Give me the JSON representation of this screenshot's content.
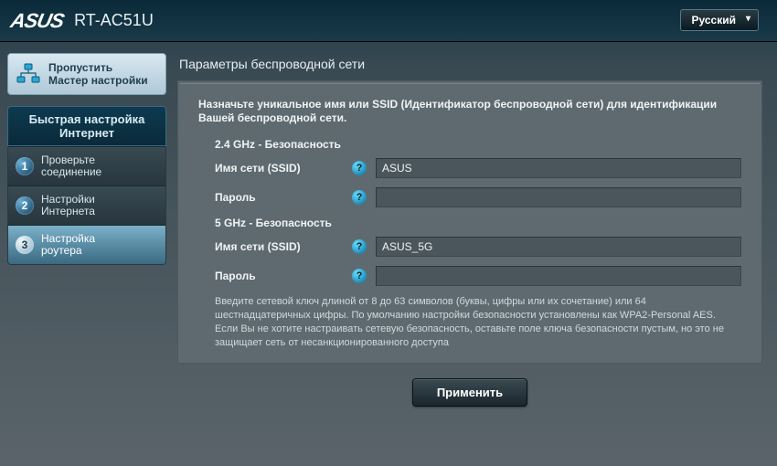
{
  "header": {
    "brand": "ASUS",
    "model": "RT-AC51U",
    "language": "Русский"
  },
  "sidebar": {
    "skip": {
      "line1": "Пропустить",
      "line2": "Мастер настройки"
    },
    "qis_title_line1": "Быстрая настройка",
    "qis_title_line2": "Интернет",
    "steps": [
      {
        "num": "1",
        "label_line1": "Проверьте",
        "label_line2": "соединение",
        "active": false
      },
      {
        "num": "2",
        "label_line1": "Настройки",
        "label_line2": "Интернета",
        "active": false
      },
      {
        "num": "3",
        "label_line1": "Настройка",
        "label_line2": "роутера",
        "active": true
      }
    ]
  },
  "main": {
    "panel_title": "Параметры беспроводной сети",
    "intro": "Назначьте уникальное имя или SSID (Идентификатор беспроводной сети) для идентификации Вашей беспроводной сети.",
    "band24_title": "2.4 GHz - Безопасность",
    "band5_title": "5 GHz - Безопасность",
    "labels": {
      "ssid": "Имя сети (SSID)",
      "password": "Пароль"
    },
    "values": {
      "ssid24": "ASUS",
      "pwd24": "",
      "ssid5": "ASUS_5G",
      "pwd5": ""
    },
    "hint": "Введите сетевой ключ длиной от 8 до 63 символов (буквы, цифры или их сочетание) или 64 шестнадцатеричных цифры. По умолчанию настройки безопасности установлены как WPA2-Personal AES. Если Вы не хотите настраивать сетевую безопасность, оставьте поле ключа безопасности пустым, но это не защищает сеть от несанкционированного доступа",
    "apply": "Применить",
    "help_glyph": "?"
  }
}
